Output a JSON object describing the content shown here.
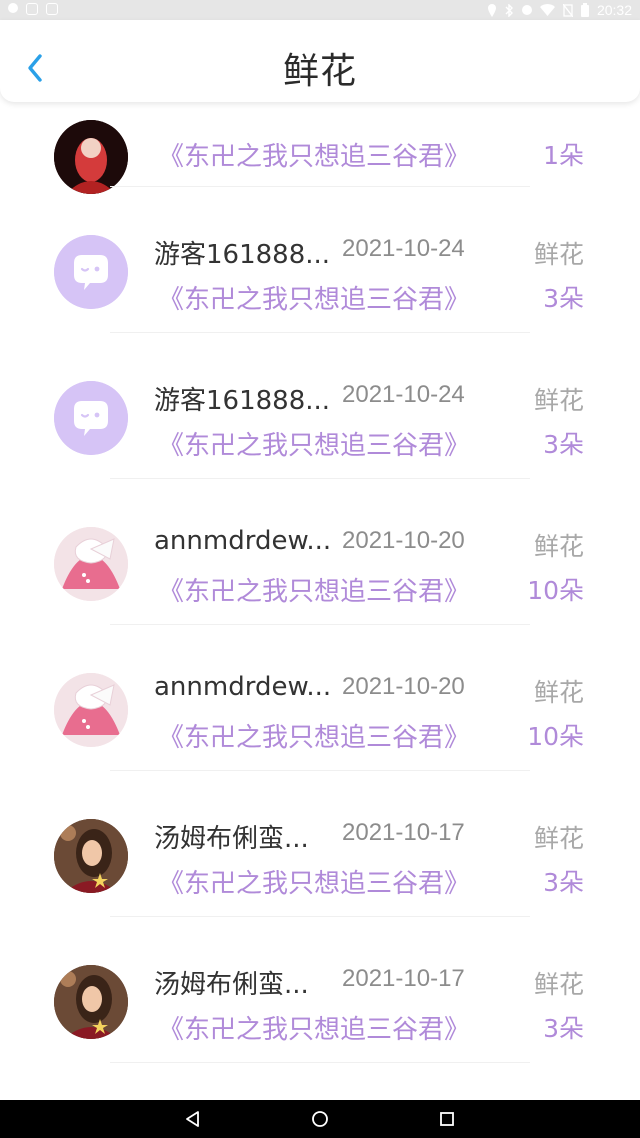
{
  "status_bar": {
    "time": "20:32",
    "icons_left": [
      "record-icon",
      "image-icon",
      "mail-icon"
    ],
    "icons_right": [
      "location-icon",
      "bluetooth-icon",
      "minus-circle-icon",
      "wifi-icon",
      "no-sim-icon",
      "battery-icon"
    ]
  },
  "header": {
    "title": "鲜花",
    "back_icon": "chevron-left-icon",
    "accent_color": "#2aa0e8"
  },
  "list": {
    "partial_top": {
      "book": "《东卍之我只想追三谷君》",
      "count": "1朵"
    },
    "items": [
      {
        "name": "游客161888...",
        "date": "2021-10-24",
        "gift": "鲜花",
        "book": "《东卍之我只想追三谷君》",
        "count": "3朵",
        "avatar": "chat-bubble-avatar"
      },
      {
        "name": "游客161888...",
        "date": "2021-10-24",
        "gift": "鲜花",
        "book": "《东卍之我只想追三谷君》",
        "count": "3朵",
        "avatar": "chat-bubble-avatar"
      },
      {
        "name": "annmdrdew...",
        "date": "2021-10-20",
        "gift": "鲜花",
        "book": "《东卍之我只想追三谷君》",
        "count": "10朵",
        "avatar": "pink-bow-avatar"
      },
      {
        "name": "annmdrdew...",
        "date": "2021-10-20",
        "gift": "鲜花",
        "book": "《东卍之我只想追三谷君》",
        "count": "10朵",
        "avatar": "pink-bow-avatar"
      },
      {
        "name": "汤姆布俐蛮...",
        "date": "2021-10-17",
        "gift": "鲜花",
        "book": "《东卍之我只想追三谷君》",
        "count": "3朵",
        "avatar": "portrait-avatar"
      },
      {
        "name": "汤姆布俐蛮...",
        "date": "2021-10-17",
        "gift": "鲜花",
        "book": "《东卍之我只想追三谷君》",
        "count": "3朵",
        "avatar": "portrait-avatar"
      }
    ]
  },
  "colors": {
    "book_purple": "#b08ad9",
    "avatar_lavender": "#d6c4f6",
    "name_text": "#333333",
    "date_text": "#8c8c8c"
  },
  "nav_bar": {
    "buttons": [
      "back-triangle-icon",
      "home-circle-icon",
      "recents-square-icon"
    ]
  }
}
